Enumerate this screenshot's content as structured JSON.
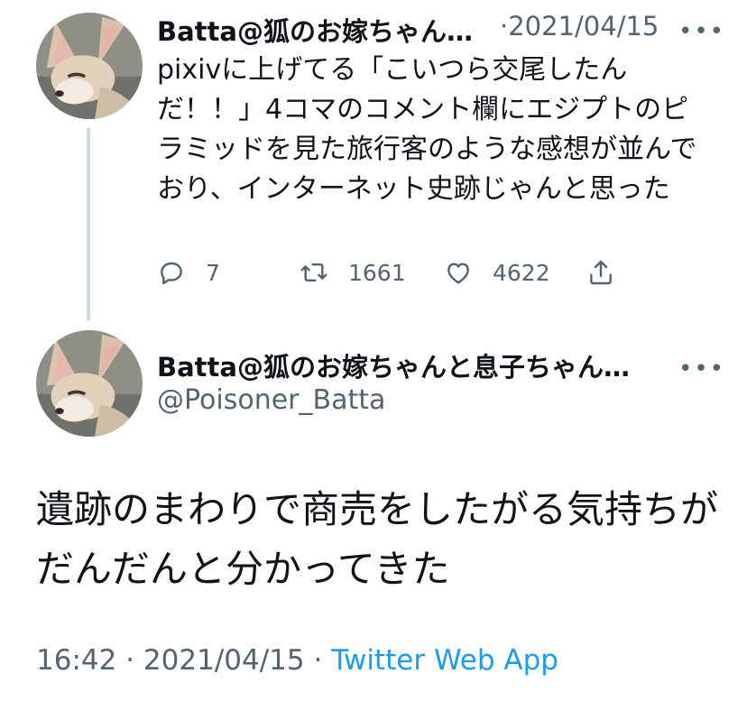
{
  "tweet1": {
    "display_name": "Batta@狐のお嫁ちゃん…",
    "separator": "·",
    "date": "2021/04/15",
    "text": "pixivに上げてる「こいつら交尾したんだ！！」4コマのコメント欄にエジプトのピラミッドを見た旅行客のような感想が並んでおり、インターネット史跡じゃんと思った",
    "reply_count": "7",
    "retweet_count": "1661",
    "like_count": "4622",
    "more_icon": "•••"
  },
  "tweet2": {
    "display_name": "Batta@狐のお嫁ちゃんと息子ちゃん…",
    "handle": "@Poisoner_Batta",
    "text": "遺跡のまわりで商売をしたがる気持ちがだんだんと分かってきた",
    "more_icon": "•••",
    "time": "16:42",
    "date": "2021/04/15",
    "separator": "·",
    "source": "Twitter Web App"
  },
  "colors": {
    "text": "#0f1419",
    "secondary": "#536471",
    "link": "#1d9bf0",
    "thread_line": "#cfd9de"
  }
}
